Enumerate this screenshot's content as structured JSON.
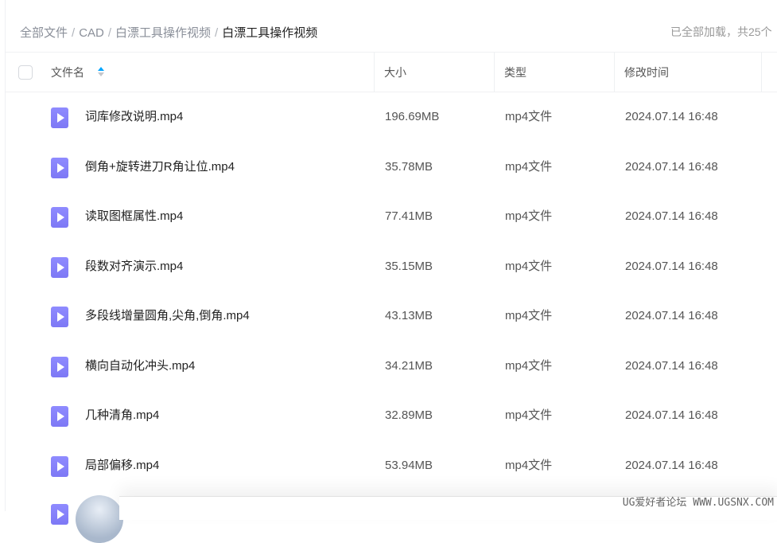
{
  "breadcrumb": [
    "全部文件",
    "CAD",
    "白漂工具操作视频",
    "白漂工具操作视频"
  ],
  "status": "已全部加载，共25个",
  "columns": {
    "name": "文件名",
    "size": "大小",
    "type": "类型",
    "modified": "修改时间"
  },
  "files": [
    {
      "name": "词库修改说明.mp4",
      "size": "196.69MB",
      "type": "mp4文件",
      "modified": "2024.07.14 16:48"
    },
    {
      "name": "倒角+旋转进刀R角让位.mp4",
      "size": "35.78MB",
      "type": "mp4文件",
      "modified": "2024.07.14 16:48"
    },
    {
      "name": "读取图框属性.mp4",
      "size": "77.41MB",
      "type": "mp4文件",
      "modified": "2024.07.14 16:48"
    },
    {
      "name": "段数对齐演示.mp4",
      "size": "35.15MB",
      "type": "mp4文件",
      "modified": "2024.07.14 16:48"
    },
    {
      "name": "多段线增量圆角,尖角,倒角.mp4",
      "size": "43.13MB",
      "type": "mp4文件",
      "modified": "2024.07.14 16:48"
    },
    {
      "name": "横向自动化冲头.mp4",
      "size": "34.21MB",
      "type": "mp4文件",
      "modified": "2024.07.14 16:48"
    },
    {
      "name": "几种清角.mp4",
      "size": "32.89MB",
      "type": "mp4文件",
      "modified": "2024.07.14 16:48"
    },
    {
      "name": "局部偏移.mp4",
      "size": "53.94MB",
      "type": "mp4文件",
      "modified": "2024.07.14 16:48"
    }
  ],
  "watermark": "UG爱好者论坛 WWW.UGSNX.COM"
}
